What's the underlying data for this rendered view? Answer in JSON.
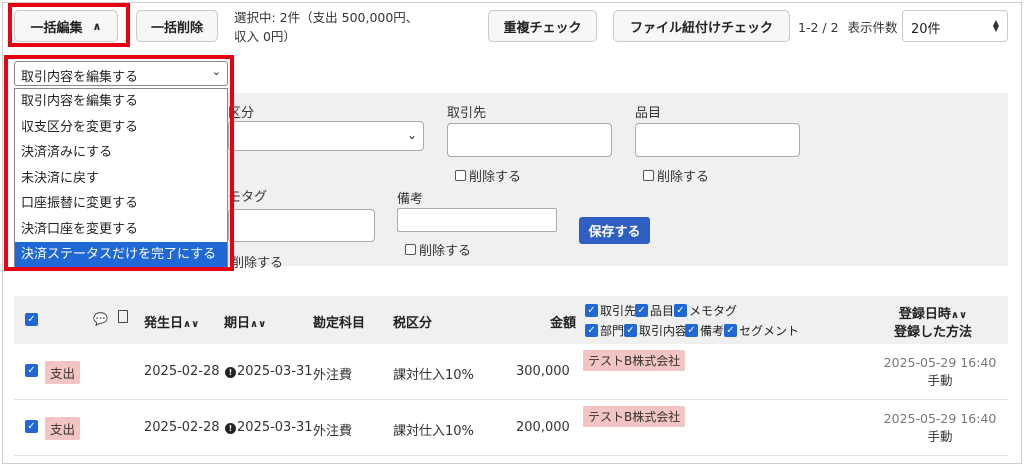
{
  "toolbar": {
    "bulk_edit": "一括編集",
    "bulk_delete": "一括削除",
    "status_line1": "選択中: 2件（支出 500,000円、",
    "status_line2": "収入 0円）",
    "dup_check": "重複チェック",
    "file_check": "ファイル紐付けチェック",
    "pager": "1-2 / 2",
    "per_page_label": "表示件数",
    "per_page_value": "20件"
  },
  "dropdown": {
    "selected": "取引内容を編集する",
    "options": [
      "取引内容を編集する",
      "収支区分を変更する",
      "決済済みにする",
      "未決済に戻す",
      "口座振替に変更する",
      "決済口座を変更する",
      "決済ステータスだけを完了にする"
    ]
  },
  "form": {
    "tax_label_partial": "区分",
    "partner_label": "取引先",
    "item_label": "品目",
    "delete_label": "削除する",
    "memo_label_partial": "モタグ",
    "note_label": "備考",
    "save": "保存する"
  },
  "table": {
    "headers": {
      "date": "発生日",
      "due": "期日",
      "account": "勘定科目",
      "tax": "税区分",
      "amount": "金額",
      "registered": "登録日時",
      "method": "登録した方法"
    },
    "filters": [
      "取引先",
      "品目",
      "メモタグ",
      "部門",
      "取引内容",
      "備考",
      "セグメント"
    ],
    "rows": [
      {
        "type": "支出",
        "date": "2025-02-28",
        "due": "2025-03-31",
        "account": "外注費",
        "tax": "課対仕入10%",
        "amount": "300,000",
        "partner": "テストB株式会社",
        "registered": "2025-05-29 16:40",
        "method": "手動"
      },
      {
        "type": "支出",
        "date": "2025-02-28",
        "due": "2025-03-31",
        "account": "外注費",
        "tax": "課対仕入10%",
        "amount": "200,000",
        "partner": "テストB株式会社",
        "registered": "2025-05-29 16:40",
        "method": "手動"
      }
    ]
  },
  "colors": {
    "accent": "#1f68d6",
    "save_button": "#2f5fc4",
    "highlight": "#e60012",
    "tag": "#f3c4c4"
  }
}
